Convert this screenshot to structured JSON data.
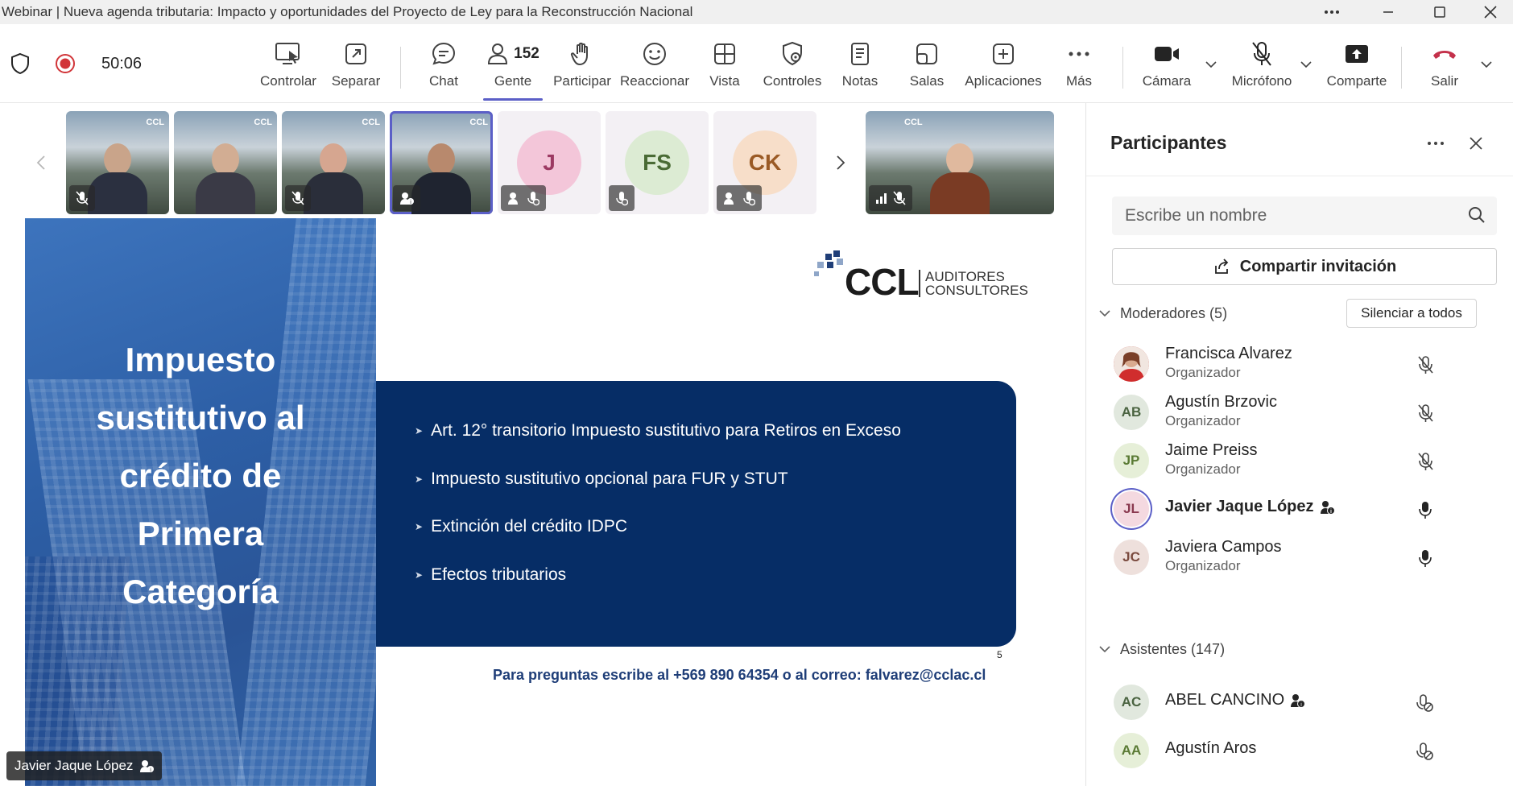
{
  "window": {
    "title": "Webinar | Nueva agenda tributaria: Impacto y oportunidades del Proyecto de Ley para la Reconstrucción Nacional"
  },
  "toolbar": {
    "timer": "50:06",
    "people_count": "152",
    "buttons": {
      "controlar": "Controlar",
      "separar": "Separar",
      "chat": "Chat",
      "gente": "Gente",
      "participar": "Participar",
      "reaccionar": "Reaccionar",
      "vista": "Vista",
      "controles": "Controles",
      "notas": "Notas",
      "salas": "Salas",
      "aplicaciones": "Aplicaciones",
      "mas": "Más",
      "camara": "Cámara",
      "microfono": "Micrófono",
      "comparte": "Comparte",
      "salir": "Salir"
    }
  },
  "strip": {
    "avatars": [
      {
        "initials": "J",
        "bg": "#f3c6d9",
        "fg": "#9c3a63"
      },
      {
        "initials": "FS",
        "bg": "#dcebd3",
        "fg": "#4a6b35"
      },
      {
        "initials": "CK",
        "bg": "#f7dec9",
        "fg": "#9a5a25"
      }
    ],
    "watermark": "CCL"
  },
  "slide": {
    "title_lines": [
      "Impuesto",
      "sustitutivo al",
      "crédito de",
      "Primera",
      "Categoría"
    ],
    "logo_main": "CCL",
    "logo_sub_1": "AUDITORES",
    "logo_sub_2": "CONSULTORES",
    "bullets": [
      "Art. 12° transitorio Impuesto sustitutivo para Retiros en Exceso",
      "Impuesto sustitutivo opcional para FUR y STUT",
      "Extinción del crédito IDPC",
      "Efectos tributarios"
    ],
    "page_number": "5",
    "footer": "Para preguntas escribe al +569 890 64354 o al correo: falvarez@cclac.cl"
  },
  "speaker": {
    "name": "Javier Jaque López"
  },
  "panel": {
    "title": "Participantes",
    "search_placeholder": "Escribe un nombre",
    "invite_label": "Compartir invitación",
    "moderators_label": "Moderadores (5)",
    "mute_all_label": "Silenciar a todos",
    "attendees_label": "Asistentes (147)",
    "moderators": [
      {
        "initials": "",
        "name": "Francisca Alvarez",
        "role": "Organizador",
        "mic": "muted"
      },
      {
        "initials": "AB",
        "name": "Agustín Brzovic",
        "role": "Organizador",
        "mic": "muted"
      },
      {
        "initials": "JP",
        "name": "Jaime Preiss",
        "role": "Organizador",
        "mic": "muted"
      },
      {
        "initials": "JL",
        "name": "Javier Jaque López",
        "role": "",
        "mic": "on"
      },
      {
        "initials": "JC",
        "name": "Javiera Campos",
        "role": "Organizador",
        "mic": "on"
      }
    ],
    "attendees": [
      {
        "initials": "AC",
        "name": "ABEL CANCINO",
        "mic": "disabled"
      },
      {
        "initials": "AA",
        "name": "Agustín Aros",
        "mic": "disabled"
      }
    ]
  },
  "colors": {
    "accent": "#5b5fc7",
    "slide_blue": "#062d66",
    "leave_red": "#c4314b",
    "record_red": "#d13438"
  }
}
